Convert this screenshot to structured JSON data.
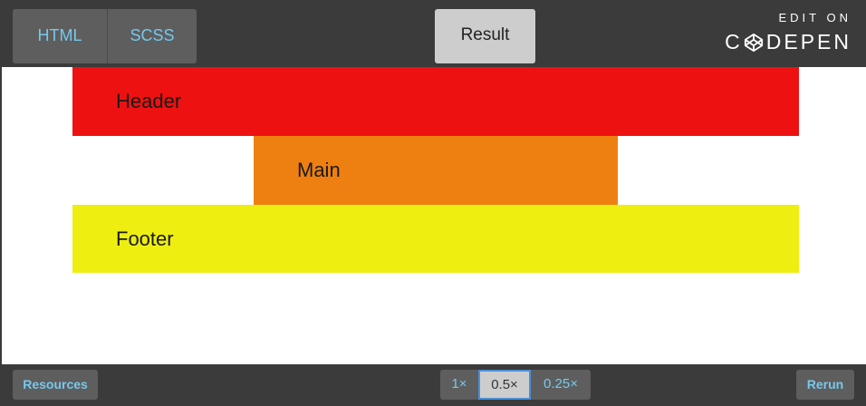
{
  "topbar": {
    "tabs": [
      {
        "label": "HTML"
      },
      {
        "label": "SCSS"
      }
    ],
    "result_label": "Result",
    "codepen": {
      "edit_on": "EDIT ON",
      "brand_left": "C",
      "brand_right": "DEPEN"
    }
  },
  "preview": {
    "header_text": "Header",
    "main_text": "Main",
    "footer_text": "Footer",
    "colors": {
      "header": "#ee1111",
      "main": "#ee8011",
      "footer": "#eeee11"
    }
  },
  "bottombar": {
    "resources_label": "Resources",
    "zoom": [
      {
        "label": "1×",
        "selected": false
      },
      {
        "label": "0.5×",
        "selected": true
      },
      {
        "label": "0.25×",
        "selected": false
      }
    ],
    "rerun_label": "Rerun"
  },
  "theme": {
    "bar_bg": "#3b3b3b",
    "accent": "#76c8ee"
  }
}
